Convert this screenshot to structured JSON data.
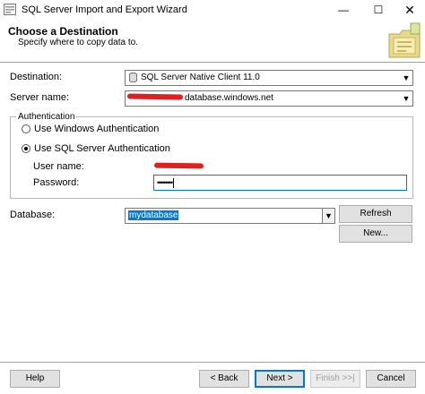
{
  "window": {
    "title": "SQL Server Import and Export Wizard",
    "minimize_glyph": "—",
    "maximize_glyph": "☐",
    "close_glyph": "✕"
  },
  "header": {
    "title": "Choose a Destination",
    "subtitle": "Specify where to copy data to."
  },
  "form": {
    "destination_label": "Destination:",
    "destination_value": "SQL Server Native Client 11.0",
    "server_label": "Server name:",
    "server_value_visible": "database.windows.net",
    "auth_group_label": "Authentication",
    "windows_auth_label": "Use Windows Authentication",
    "sql_auth_label": "Use SQL Server Authentication",
    "selected_auth": "sql",
    "username_label": "User name:",
    "password_label": "Password:",
    "password_value": "••••••••",
    "database_label": "Database:",
    "database_value": "mydatabase"
  },
  "buttons": {
    "refresh": "Refresh",
    "new": "New...",
    "help": "Help",
    "back": "< Back",
    "next": "Next >",
    "finish": "Finish >>|",
    "cancel": "Cancel"
  },
  "icons": {
    "app": "wizard-app-icon",
    "destination": "database-icon",
    "dropdown": "chevron-down-icon",
    "header_art": "folder-wizard-icon"
  },
  "colors": {
    "accent": "#0078d7",
    "redaction": "#e02020"
  }
}
